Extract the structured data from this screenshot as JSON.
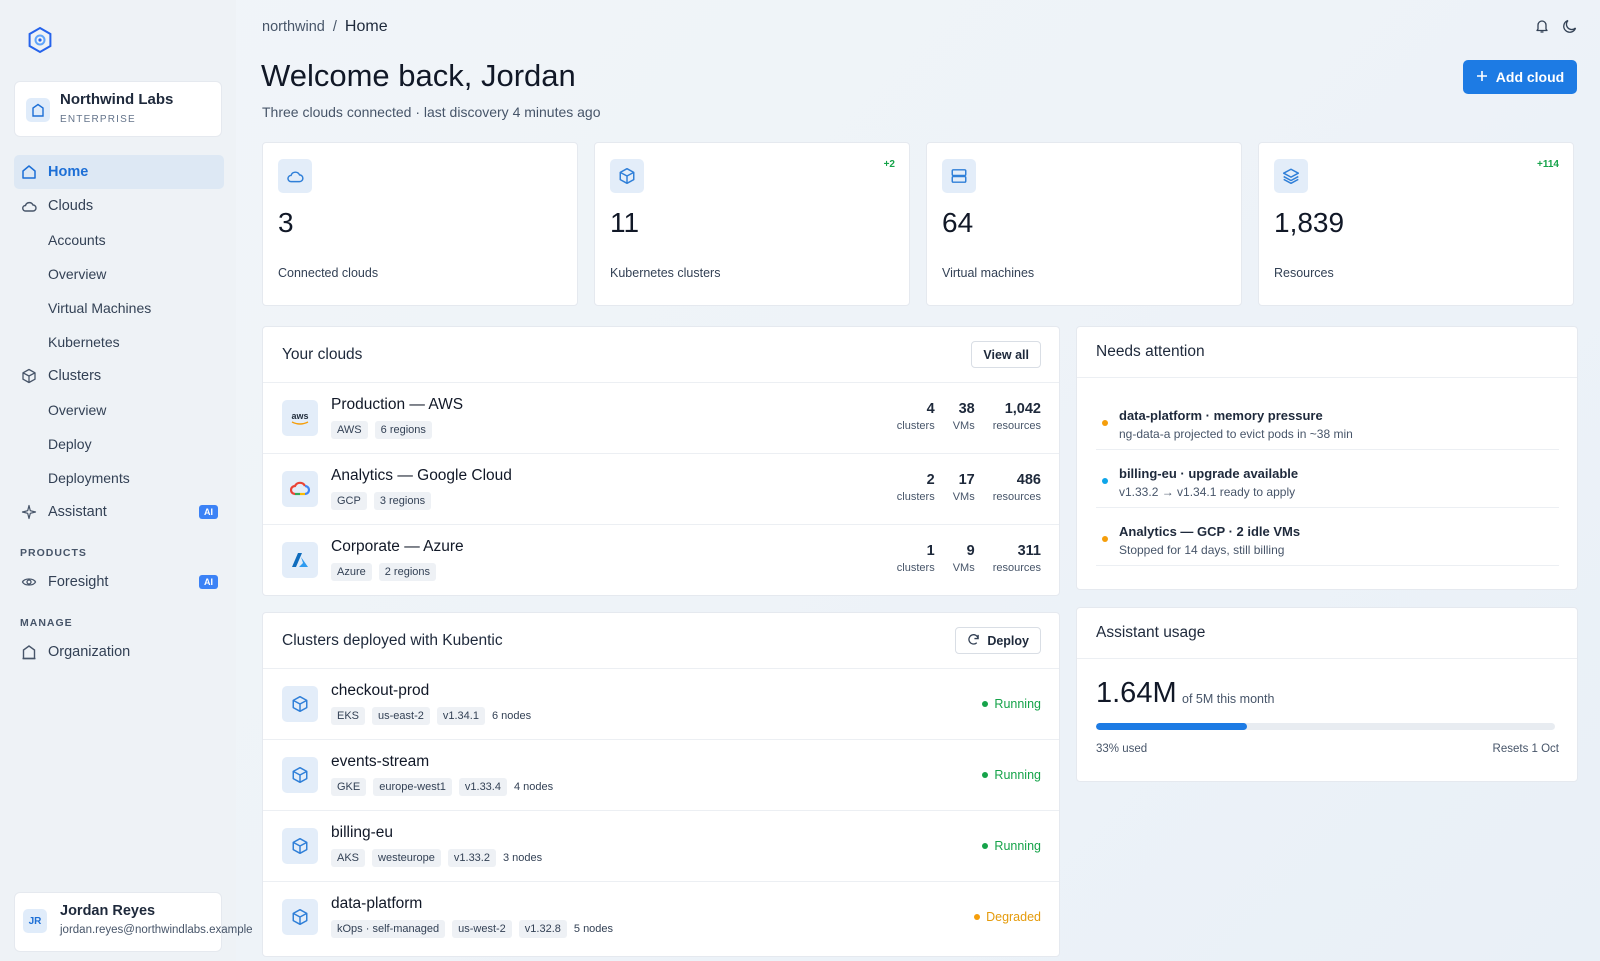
{
  "org": {
    "name": "Northwind Labs",
    "plan": "ENTERPRISE"
  },
  "nav": {
    "home": "Home",
    "clouds": "Clouds",
    "clouds_sub": [
      "Accounts",
      "Overview",
      "Virtual Machines",
      "Kubernetes"
    ],
    "clusters": "Clusters",
    "clusters_sub": [
      "Overview",
      "Deploy",
      "Deployments"
    ],
    "assistant": "Assistant",
    "ai_badge": "AI",
    "products_label": "PRODUCTS",
    "foresight": "Foresight",
    "manage_label": "MANAGE",
    "organization": "Organization"
  },
  "user": {
    "initials": "JR",
    "name": "Jordan Reyes",
    "email": "jordan.reyes@northwindlabs.example"
  },
  "breadcrumb": {
    "root": "northwind",
    "sep": "/",
    "current": "Home"
  },
  "header": {
    "title": "Welcome back, Jordan",
    "subtitle": "Three clouds connected · last discovery 4 minutes ago",
    "add_cloud": "Add cloud"
  },
  "stats": [
    {
      "value": "3",
      "label": "Connected clouds",
      "delta": "",
      "icon": "cloud-icon"
    },
    {
      "value": "11",
      "label": "Kubernetes clusters",
      "delta": "+2",
      "icon": "cube-icon"
    },
    {
      "value": "64",
      "label": "Virtual machines",
      "delta": "",
      "icon": "server-icon"
    },
    {
      "value": "1,839",
      "label": "Resources",
      "delta": "+114",
      "icon": "layers-icon"
    }
  ],
  "clouds_panel": {
    "title": "Your clouds",
    "view_all": "View all",
    "rows": [
      {
        "name": "Production — AWS",
        "provider": "AWS",
        "regions": "6 regions",
        "clusters": "4",
        "vms": "38",
        "resources": "1,042",
        "icon": "aws"
      },
      {
        "name": "Analytics — Google Cloud",
        "provider": "GCP",
        "regions": "3 regions",
        "clusters": "2",
        "vms": "17",
        "resources": "486",
        "icon": "gcp"
      },
      {
        "name": "Corporate — Azure",
        "provider": "Azure",
        "regions": "2 regions",
        "clusters": "1",
        "vms": "9",
        "resources": "311",
        "icon": "azure"
      }
    ],
    "labels": {
      "clusters": "clusters",
      "vms": "VMs",
      "resources": "resources"
    },
    "aws_logo_text": "aws"
  },
  "clusters_panel": {
    "title": "Clusters deployed with Kubentic",
    "deploy": "Deploy",
    "rows": [
      {
        "name": "checkout-prod",
        "tags": [
          "EKS",
          "us-east-2",
          "v1.34.1"
        ],
        "nodes": "6 nodes",
        "status": "Running"
      },
      {
        "name": "events-stream",
        "tags": [
          "GKE",
          "europe-west1",
          "v1.33.4"
        ],
        "nodes": "4 nodes",
        "status": "Running"
      },
      {
        "name": "billing-eu",
        "tags": [
          "AKS",
          "westeurope",
          "v1.33.2"
        ],
        "nodes": "3 nodes",
        "status": "Running"
      },
      {
        "name": "data-platform",
        "tags": [
          "kOps · self-managed",
          "us-west-2",
          "v1.32.8"
        ],
        "nodes": "5 nodes",
        "status": "Degraded"
      }
    ]
  },
  "attention": {
    "title": "Needs attention",
    "items": [
      {
        "title": "data-platform · memory pressure",
        "desc": "ng-data-a projected to evict pods in ~38 min",
        "color": "#f59e0b"
      },
      {
        "title": "billing-eu · upgrade available",
        "desc": "v1.33.2 → v1.34.1 ready to apply",
        "color": "#0ea5e9"
      },
      {
        "title": "Analytics — GCP · 2 idle VMs",
        "desc": "Stopped for 14 days, still billing",
        "color": "#f59e0b"
      }
    ]
  },
  "usage": {
    "title": "Assistant usage",
    "value": "1.64M",
    "of": "of 5M this month",
    "fraction": 0.33,
    "used": "33% used",
    "resets": "Resets 1 Oct"
  },
  "colors": {
    "accent": "#1d7be4",
    "running": "#16a34a",
    "degraded": "#f59e0b"
  }
}
